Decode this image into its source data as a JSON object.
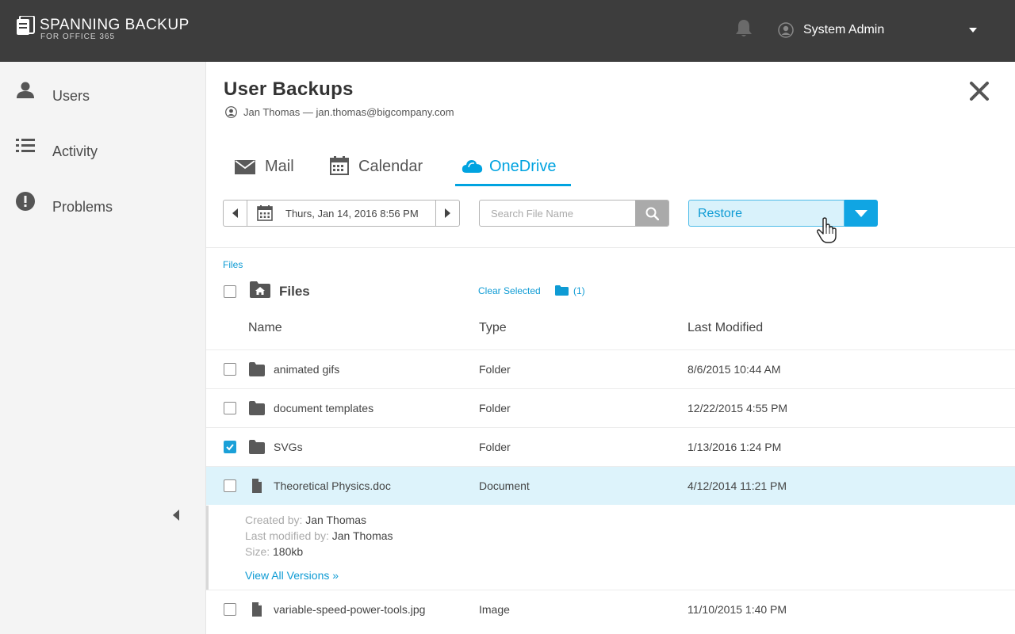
{
  "header": {
    "logo_main": "SPANNING BACKUP",
    "logo_sub": "FOR OFFICE 365",
    "user_name": "System Admin"
  },
  "sidebar": {
    "items": [
      {
        "label": "Users",
        "icon": "user-icon"
      },
      {
        "label": "Activity",
        "icon": "list-icon"
      },
      {
        "label": "Problems",
        "icon": "alert-icon"
      }
    ]
  },
  "panel": {
    "title": "User Backups",
    "subtitle": "Jan Thomas — jan.thomas@bigcompany.com"
  },
  "tabs": [
    {
      "label": "Mail",
      "icon": "mail-icon",
      "active": false
    },
    {
      "label": "Calendar",
      "icon": "calendar-icon",
      "active": false
    },
    {
      "label": "OneDrive",
      "icon": "cloud-icon",
      "active": true
    }
  ],
  "toolbar": {
    "date": "Thurs, Jan 14, 2016 8:56 PM",
    "search_placeholder": "Search File Name",
    "restore_label": "Restore"
  },
  "browser": {
    "breadcrumb": "Files",
    "folder_title": "Files",
    "clear_selected": "Clear Selected",
    "selected_count": "(1)",
    "columns": {
      "name": "Name",
      "type": "Type",
      "modified": "Last Modified"
    }
  },
  "rows": [
    {
      "name": "animated gifs",
      "type": "Folder",
      "modified": "8/6/2015 10:44 AM",
      "kind": "folder",
      "checked": false
    },
    {
      "name": "document templates",
      "type": "Folder",
      "modified": "12/22/2015 4:55 PM",
      "kind": "folder",
      "checked": false
    },
    {
      "name": "SVGs",
      "type": "Folder",
      "modified": "1/13/2016 1:24 PM",
      "kind": "folder",
      "checked": true
    },
    {
      "name": "Theoretical Physics.doc",
      "type": "Document",
      "modified": "4/12/2014 11:21 PM",
      "kind": "file",
      "checked": false
    },
    {
      "name": "variable-speed-power-tools.jpg",
      "type": "Image",
      "modified": "11/10/2015 1:40 PM",
      "kind": "file",
      "checked": false
    }
  ],
  "details": {
    "created_by_label": "Created by:",
    "created_by": "Jan Thomas",
    "modified_by_label": "Last modified by:",
    "modified_by": "Jan Thomas",
    "size_label": "Size:",
    "size": "180kb",
    "view_versions": "View All Versions »"
  },
  "colors": {
    "accent": "#00a3e0",
    "topbar": "#3d3d3d",
    "highlight_row": "#ddf3fb"
  }
}
